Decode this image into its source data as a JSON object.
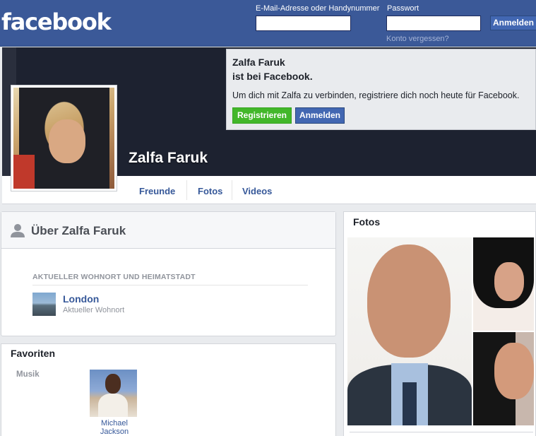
{
  "header": {
    "logo": "facebook",
    "email_label": "E-Mail-Adresse oder Handynummer",
    "password_label": "Passwort",
    "login_button": "Anmelden",
    "forgot_link": "Konto vergessen?"
  },
  "signup": {
    "name": "Zalfa Faruk",
    "subtitle": "ist bei Facebook.",
    "text": "Um dich mit Zalfa zu verbinden, registriere dich noch heute für Facebook.",
    "register_button": "Registrieren",
    "login_button": "Anmelden"
  },
  "profile": {
    "name": "Zalfa Faruk"
  },
  "tabs": [
    {
      "label": "Freunde"
    },
    {
      "label": "Fotos"
    },
    {
      "label": "Videos"
    }
  ],
  "about": {
    "title": "Über Zalfa Faruk",
    "section_label": "AKTUELLER WOHNORT UND HEIMATSTADT",
    "city": "London",
    "city_sub": "Aktueller Wohnort"
  },
  "favorites": {
    "title": "Favoriten",
    "category": "Musik",
    "item_line1": "Michael",
    "item_line2": "Jackson"
  },
  "photos": {
    "title": "Fotos"
  },
  "colors": {
    "brand_blue": "#3b5998",
    "cover_dark": "#1d2230",
    "register_green": "#42b72a",
    "link_blue": "#365899"
  }
}
